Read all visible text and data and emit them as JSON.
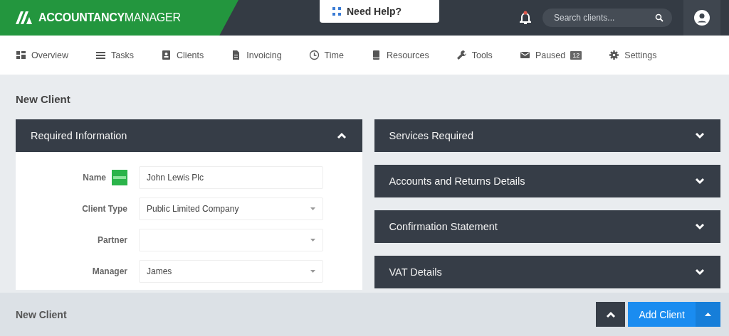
{
  "header": {
    "logo": "**ACCOUNTANCY**MANAGER",
    "help": "Need Help?",
    "search": {
      "placeholder": "Search clients..."
    },
    "notification": true
  },
  "nav": [
    {
      "label": "Overview"
    },
    {
      "label": "Tasks"
    },
    {
      "label": "Clients"
    },
    {
      "label": "Invoicing"
    },
    {
      "label": "Time"
    },
    {
      "label": "Resources"
    },
    {
      "label": "Tools"
    },
    {
      "label": "Paused",
      "badge": "12"
    },
    {
      "label": "Settings"
    }
  ],
  "page_title": "New Client",
  "left_panels": [
    {
      "title": "Required Information",
      "expanded": true,
      "fields": [
        {
          "label": "Name",
          "kind": "text",
          "value": "John Lewis Plc",
          "sage": true
        },
        {
          "label": "Client Type",
          "kind": "select",
          "value": "Public Limited Company"
        },
        {
          "label": "Partner",
          "kind": "select"
        },
        {
          "label": "Manager",
          "kind": "select",
          "value": "James"
        }
      ]
    }
  ],
  "right_panels": [
    {
      "title": "Services Required",
      "expanded": false
    },
    {
      "title": "Accounts and Returns Details",
      "expanded": false
    },
    {
      "title": "Confirmation Statement",
      "expanded": false
    },
    {
      "title": "VAT Details",
      "expanded": false
    }
  ],
  "footer": {
    "title": "New Client",
    "primary": "Add Client"
  }
}
